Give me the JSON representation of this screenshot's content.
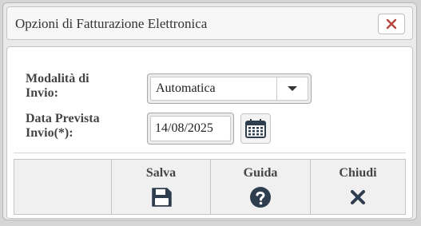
{
  "dialog": {
    "title": "Opzioni di Fatturazione Elettronica",
    "close_icon": "close-icon"
  },
  "form": {
    "mode_label_line1": "Modalità di",
    "mode_label_line2": "Invio:",
    "mode_value": "Automatica",
    "date_label_line1": "Data Prevista",
    "date_label_line2": "Invio(*):",
    "date_value": "14/08/2025",
    "calendar_icon": "calendar-icon"
  },
  "toolbar": {
    "save_label": "Salva",
    "save_icon": "floppy-disk-icon",
    "help_label": "Guida",
    "help_icon": "question-circle-icon",
    "close_label": "Chiudi",
    "close_icon": "x-icon"
  },
  "colors": {
    "close_accent": "#b5453c",
    "icon_dark": "#2e3e4f"
  }
}
